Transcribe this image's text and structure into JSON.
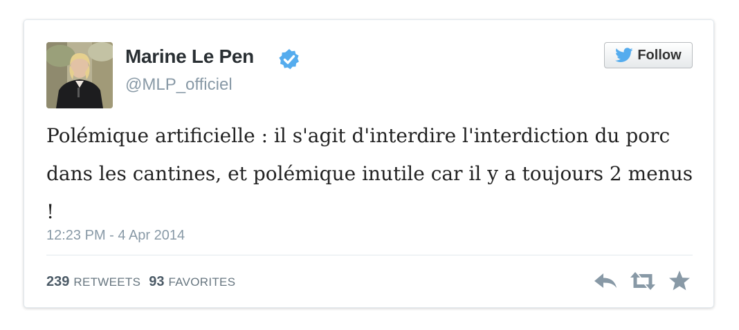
{
  "author": {
    "name": "Marine Le Pen",
    "handle": "@MLP_officiel",
    "verified": true,
    "avatar_icon": "profile-photo"
  },
  "follow_button": {
    "label": "Follow",
    "icon": "twitter-bird-icon"
  },
  "tweet": {
    "text": "Polémique artificielle : il s'agit d'interdire l'interdiction du porc dans les cantines, et polémique inutile car il y a toujours 2 menus !",
    "timestamp": "12:23 PM - 4 Apr 2014"
  },
  "stats": {
    "retweets_count": "239",
    "retweets_label": "RETWEETS",
    "favorites_count": "93",
    "favorites_label": "FAVORITES"
  },
  "actions": [
    "reply-icon",
    "retweet-icon",
    "favorite-icon"
  ],
  "colors": {
    "verified_badge": "#55acee",
    "twitter_blue": "#55acee",
    "muted_text": "#8899a6",
    "action_icon": "#8899a6"
  }
}
